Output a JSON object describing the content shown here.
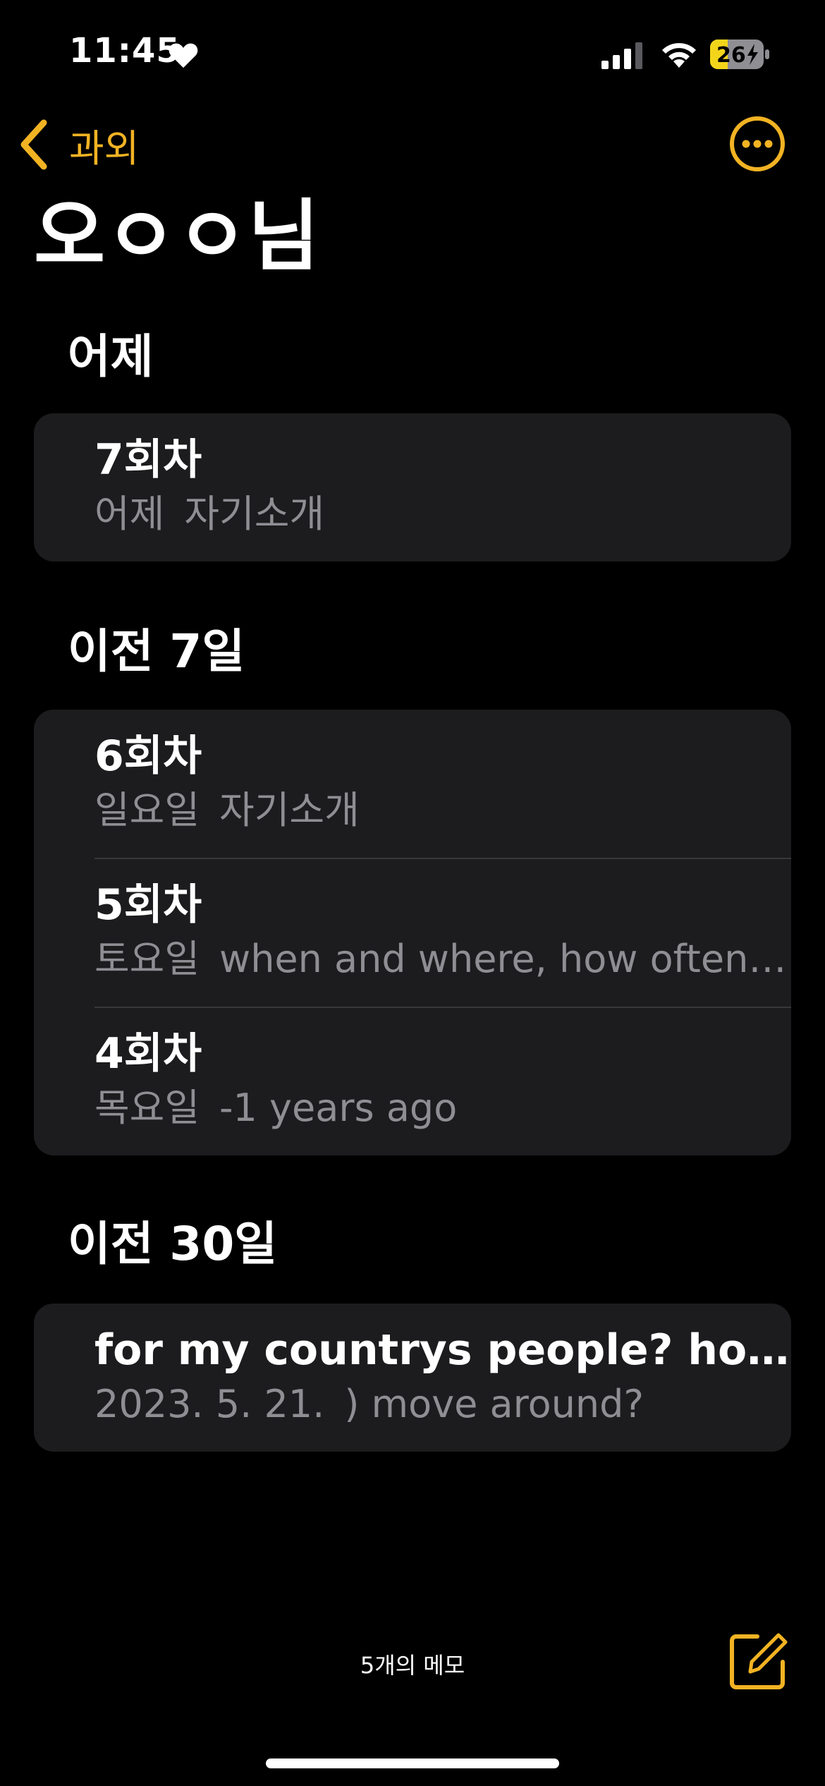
{
  "status_bar": {
    "time": "11:45",
    "battery": "26"
  },
  "nav": {
    "back_label": "과외"
  },
  "title": "오ㅇㅇ님",
  "sections": [
    {
      "header": "어제",
      "notes": [
        {
          "title": "7회차",
          "date": "어제",
          "preview": "자기소개"
        }
      ]
    },
    {
      "header": "이전 7일",
      "notes": [
        {
          "title": "6회차",
          "date": "일요일",
          "preview": "자기소개"
        },
        {
          "title": "5회차",
          "date": "토요일",
          "preview": "when and where, how often,..."
        },
        {
          "title": "4회차",
          "date": "목요일",
          "preview": "-1 years ago"
        }
      ]
    },
    {
      "header": "이전 30일",
      "notes": [
        {
          "title": "for my countrys people? how to...",
          "date": "2023. 5. 21.",
          "preview": ") move around?"
        }
      ]
    }
  ],
  "footer": {
    "memo_count": "5개의 메모"
  },
  "colors": {
    "accent": "#f2b323",
    "card_bg": "#1c1c1e",
    "secondary_text": "#8e8e93",
    "background": "#000000"
  },
  "icons": [
    "heart-icon",
    "cellular-signal-icon",
    "wifi-icon",
    "battery-icon",
    "chevron-left-icon",
    "ellipsis-circle-icon",
    "compose-icon"
  ]
}
